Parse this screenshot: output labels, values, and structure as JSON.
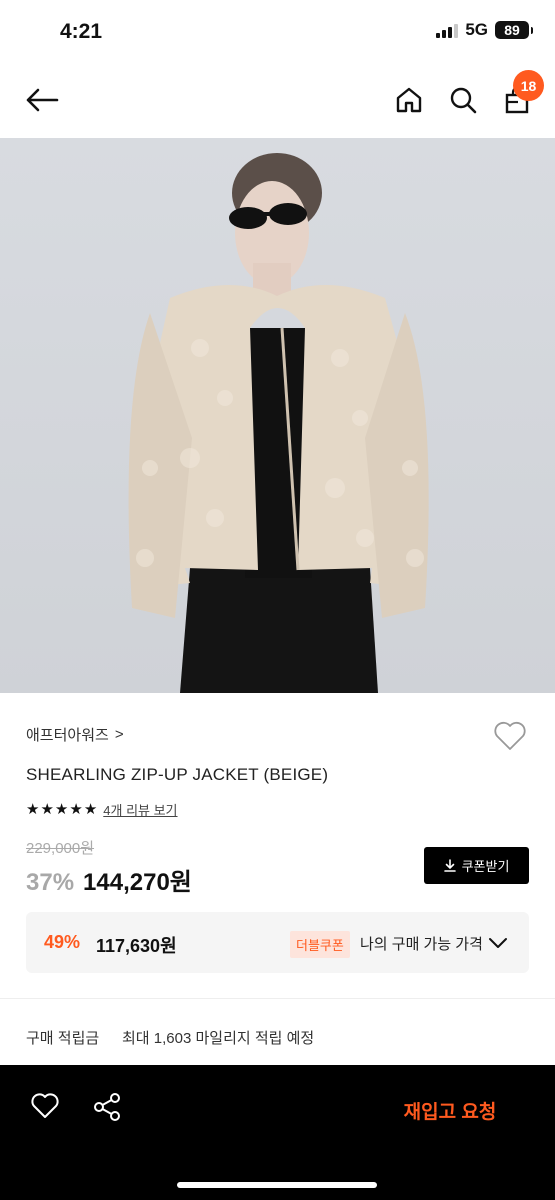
{
  "status_bar": {
    "time": "4:21",
    "network": "5G",
    "battery": "89"
  },
  "header": {
    "cart_count": "18",
    "icons": [
      "back-arrow-icon",
      "home-icon",
      "search-icon",
      "cart-bag-icon"
    ]
  },
  "product": {
    "brand": "애프터아워즈",
    "brand_chevron": ">",
    "name": "SHEARLING ZIP-UP JACKET (BEIGE)",
    "rating_stars": 5,
    "review_link": "4개 리뷰 보기",
    "original_price": "229,000원",
    "discount_percent": "37%",
    "sale_price": "144,270원",
    "coupon_button": "쿠폰받기"
  },
  "best_price": {
    "percent": "49%",
    "price": "117,630원",
    "tag": "더블쿠폰",
    "text": "나의 구매 가능 가격"
  },
  "points": {
    "label": "구매 적립금",
    "value": "최대 1,603 마일리지 적립 예정"
  },
  "bottom_bar": {
    "restock_button": "재입고 요청"
  },
  "colors": {
    "accent": "#ff5a1f",
    "bottom_bar_bg": "#000000",
    "image_bg": "#d4d7dc"
  }
}
